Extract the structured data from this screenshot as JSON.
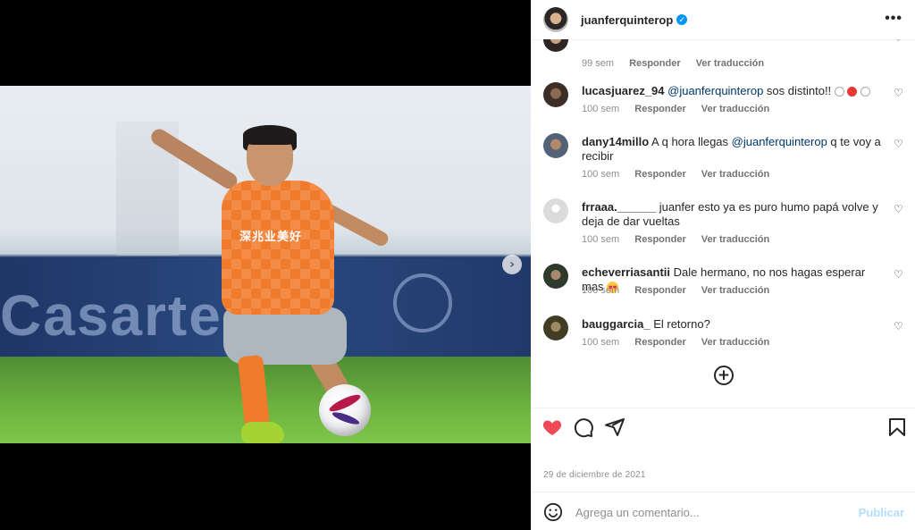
{
  "post": {
    "username": "juanferquinterop",
    "verified": true,
    "date": "29 de diciembre de 2021"
  },
  "photo": {
    "banner_text": "Casarte",
    "jersey_sponsor": "深兆业美好"
  },
  "comments": [
    {
      "user": "",
      "text": "",
      "time": "99 sem",
      "reply": "Responder",
      "translate": "Ver traducción"
    },
    {
      "user": "lucasjuarez_94",
      "mention": "@juanferquinterop",
      "text": " sos distinto!!",
      "time": "100 sem",
      "reply": "Responder",
      "translate": "Ver traducción"
    },
    {
      "user": "dany14millo",
      "text": " A q hora llegas ",
      "mention": "@juanferquinterop",
      "text2": " q te voy a recibir",
      "time": "100 sem",
      "reply": "Responder",
      "translate": "Ver traducción"
    },
    {
      "user": "frraaa.______",
      "text": " juanfer esto ya es puro humo papá volve y deja de dar vueltas",
      "time": "100 sem",
      "reply": "Responder",
      "translate": "Ver traducción"
    },
    {
      "user": "echeverriasantii",
      "text": " Dale hermano, no nos hagas esperar mas",
      "time": "100 sem",
      "reply": "Responder",
      "translate": "Ver traducción"
    },
    {
      "user": "bauggarcia_",
      "text": " El retorno?",
      "time": "100 sem",
      "reply": "Responder",
      "translate": "Ver traducción"
    }
  ],
  "comment_box": {
    "placeholder": "Agrega un comentario...",
    "publish": "Publicar"
  },
  "colors": {
    "like_red": "#ed4956",
    "verified_blue": "#0095f6",
    "mention": "#00376b",
    "publish_disabled": "#b2dffc"
  },
  "icons": [
    "more-options-icon",
    "heart-icon",
    "comment-icon",
    "share-icon",
    "save-icon",
    "emoji-icon",
    "add-circle-icon",
    "next-arrow-icon"
  ]
}
